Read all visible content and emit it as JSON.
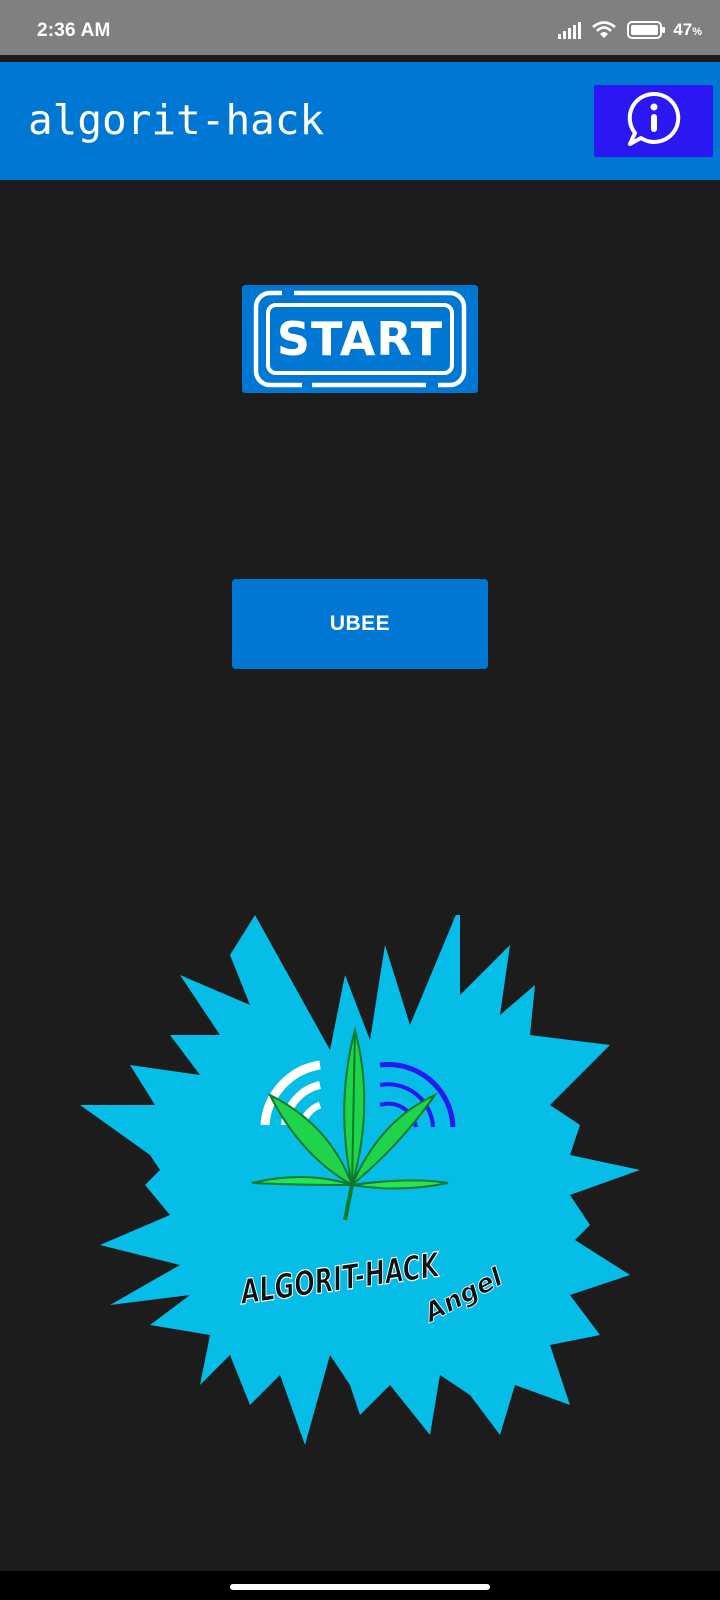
{
  "status_bar": {
    "time": "2:36 AM",
    "battery_percent": "47",
    "battery_unit": "%",
    "icons": [
      "signal-icon",
      "wifi-icon",
      "battery-icon"
    ]
  },
  "app_bar": {
    "title": "algorit-hack",
    "info_icon": "info-chat-icon"
  },
  "main": {
    "start_label": "START",
    "ubee_label": "UBEE"
  },
  "logo": {
    "title": "ALGORIT-HACK",
    "subtitle": "Angel",
    "burst_color": "#05bde6",
    "leaf_color": "#1fd44a"
  },
  "colors": {
    "primary": "#0177d4",
    "info_button": "#2a17f2",
    "background": "#1c1c1c",
    "status_bar": "#808080"
  }
}
